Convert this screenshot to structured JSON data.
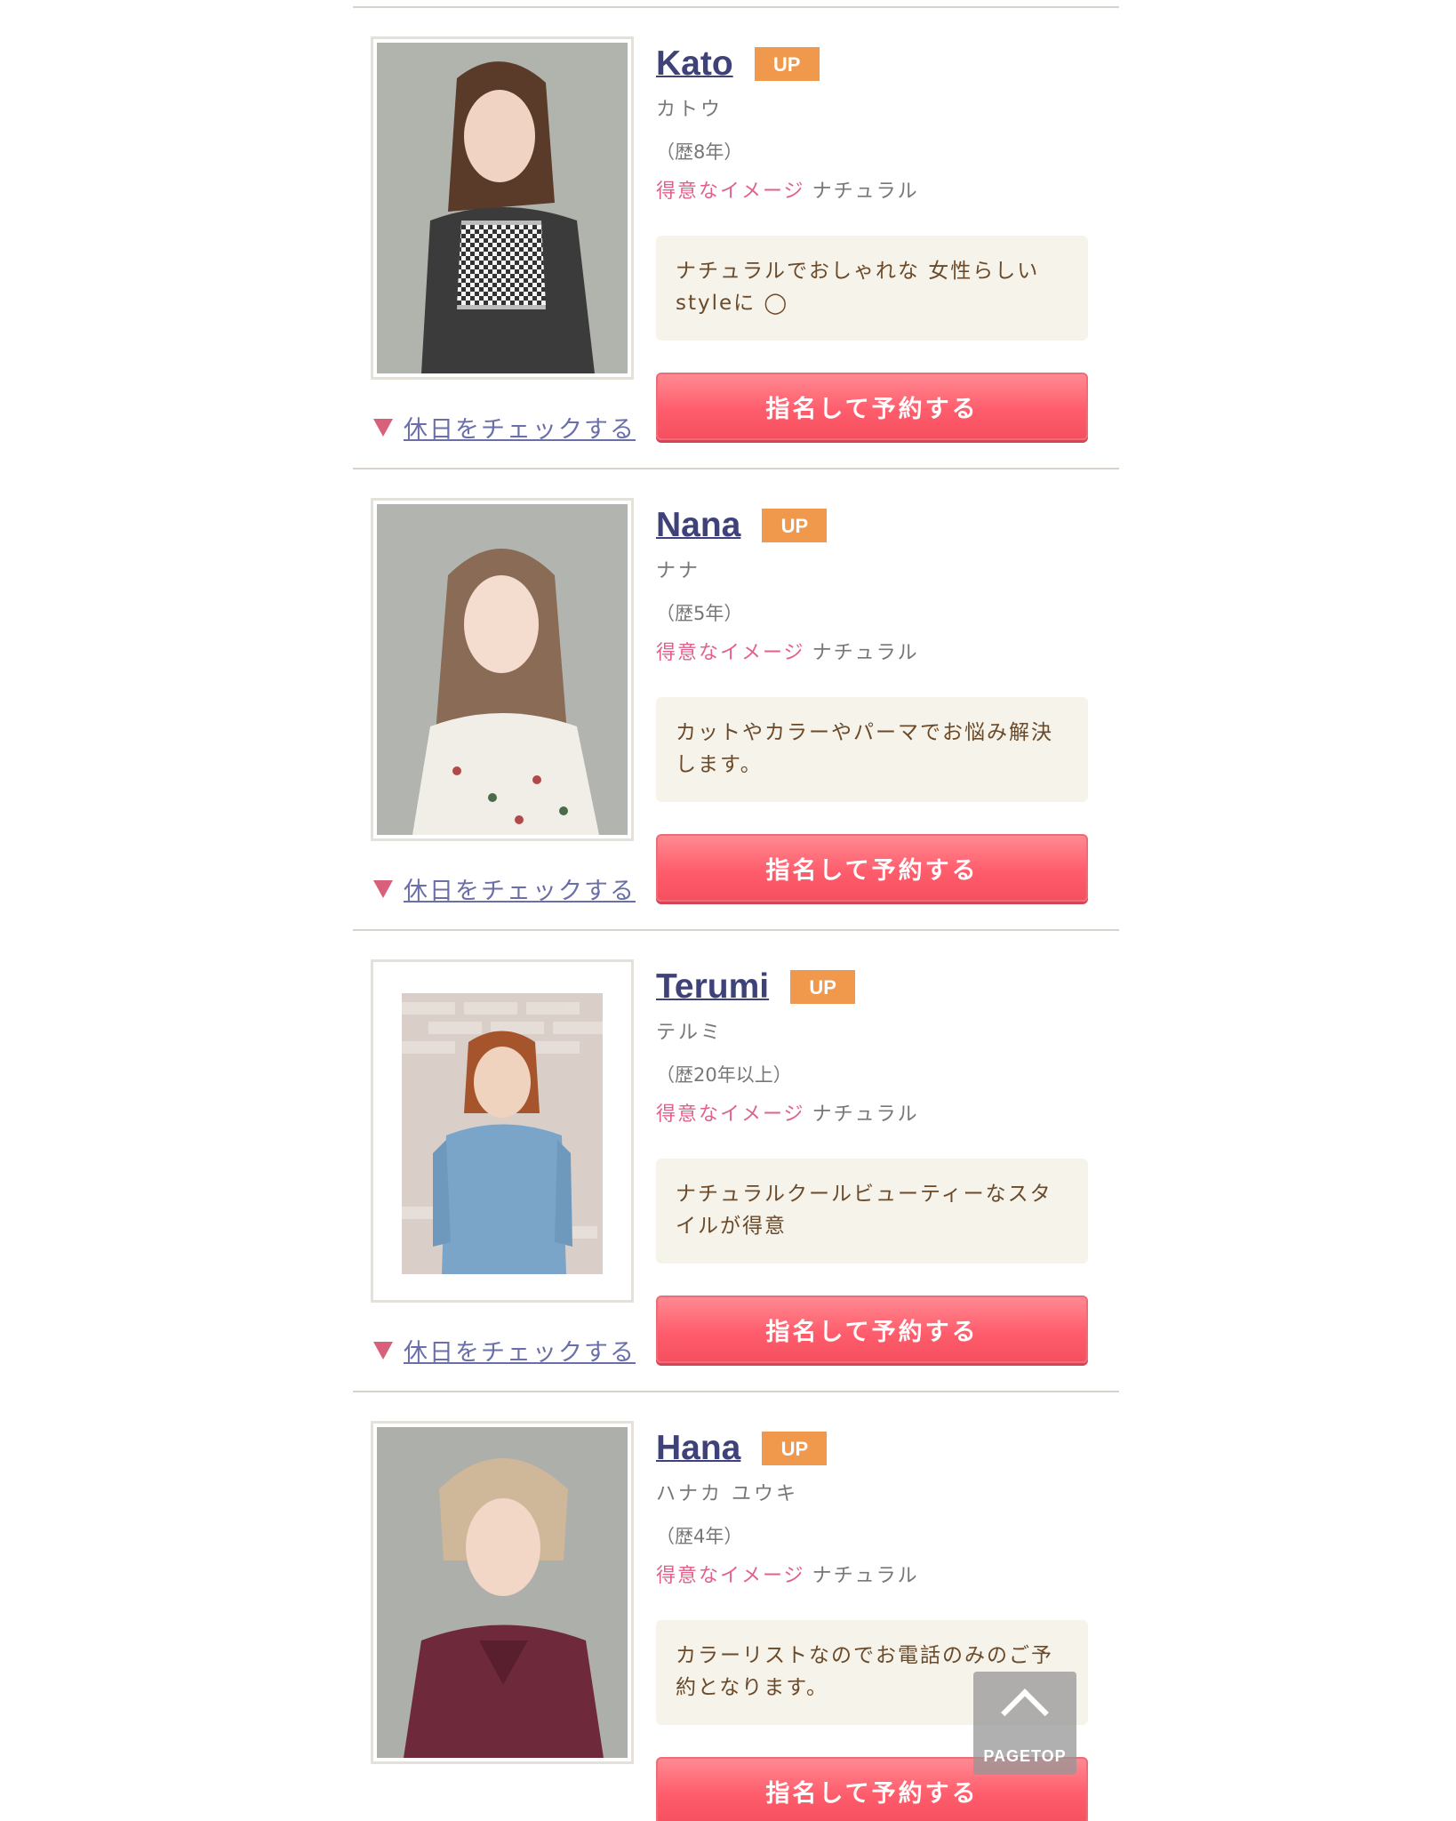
{
  "holiday_link_label": "休日をチェックする",
  "reserve_button_label": "指名して予約する",
  "specialty_label": "得意なイメージ",
  "up_badge_label": "UP",
  "pagetop_label": "PAGETOP",
  "stylists": [
    {
      "name": "Kato",
      "kana": "カトウ",
      "career": "（歴8年）",
      "specialty": "ナチュラル",
      "message": "ナチュラルでおしゃれな 女性らしいstyleに ◯"
    },
    {
      "name": "Nana",
      "kana": "ナナ",
      "career": "（歴5年）",
      "specialty": "ナチュラル",
      "message": "カットやカラーやパーマでお悩み解決します。"
    },
    {
      "name": "Terumi",
      "kana": "テルミ",
      "career": "（歴20年以上）",
      "specialty": "ナチュラル",
      "message": "ナチュラルクールビューティーなスタイルが得意"
    },
    {
      "name": "Hana",
      "kana": "ハナカ ユウキ",
      "career": "（歴4年）",
      "specialty": "ナチュラル",
      "message": "カラーリストなのでお電話のみのご予約となります。"
    }
  ],
  "colors": {
    "accent_pink": "#e0628a",
    "button_red": "#ff5d6c",
    "badge_orange": "#f0984b",
    "name_navy": "#3f4278"
  }
}
